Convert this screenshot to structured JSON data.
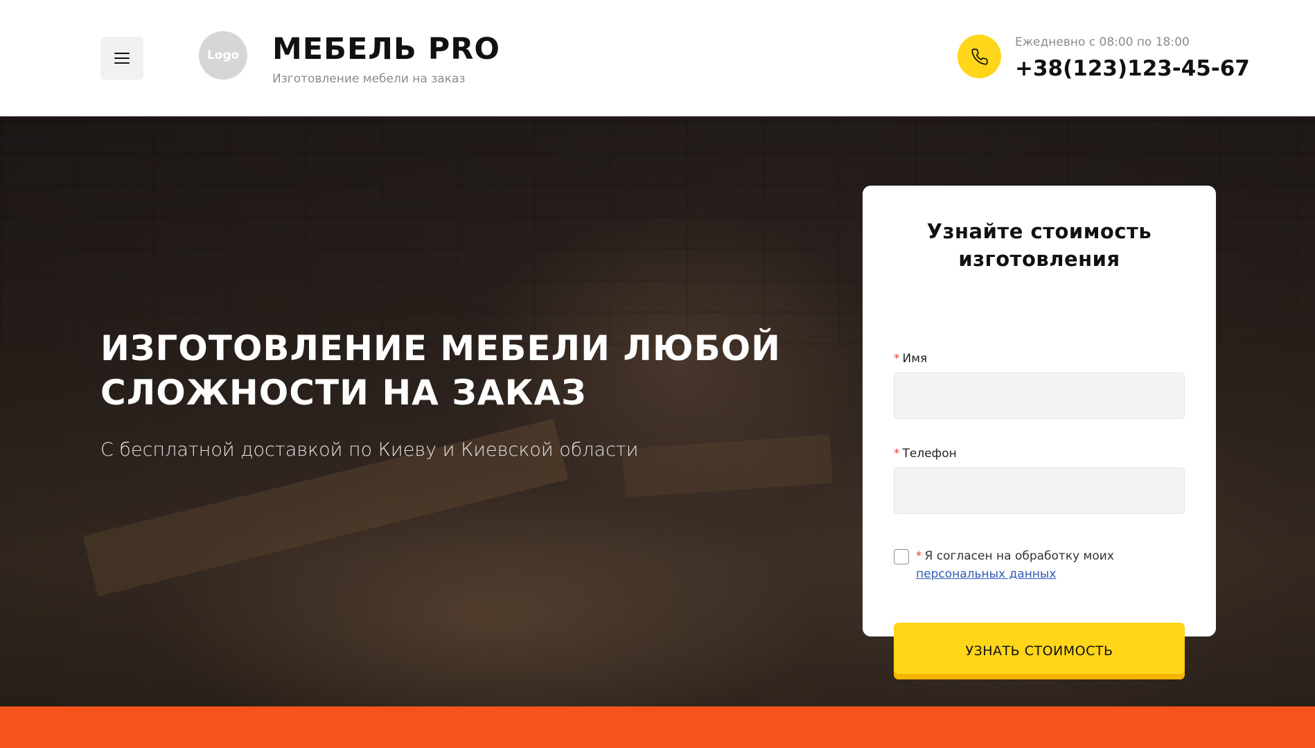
{
  "header": {
    "logo_text": "Logo",
    "brand_name": "МЕБЕЛЬ PRO",
    "brand_tagline": "Изготовление мебели на заказ",
    "hours": "Ежедневно с 08:00 по 18:00",
    "phone": "+38(123)123-45-67"
  },
  "hero": {
    "title_line1": "ИЗГОТОВЛЕНИЕ МЕБЕЛИ ЛЮБОЙ",
    "title_line2": "СЛОЖНОСТИ НА ЗАКАЗ",
    "subtitle": "С бесплатной доставкой по Киеву и Киевской области"
  },
  "form": {
    "title_line1": "Узнайте стоимость",
    "title_line2": "изготовления",
    "name_label": "Имя",
    "name_value": "",
    "phone_label": "Телефон",
    "phone_value": "",
    "required_mark": "*",
    "consent_text": "Я согласен на обработку моих",
    "consent_link": "персональных данных",
    "consent_checked": false,
    "submit_label": "УЗНАТЬ СТОИМОСТЬ"
  },
  "colors": {
    "accent_yellow": "#ffd619",
    "accent_orange": "#f4531b",
    "required_red": "#e5402f",
    "link_blue": "#2f5bb5"
  },
  "icons": {
    "menu": "hamburger-menu-icon",
    "phone": "phone-icon"
  }
}
